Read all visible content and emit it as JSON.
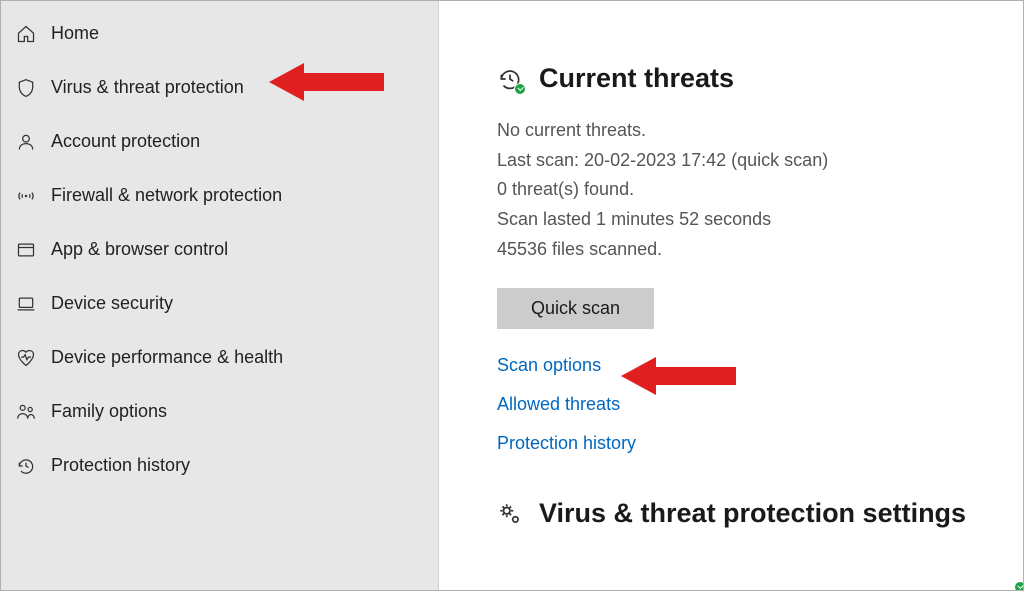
{
  "sidebar": {
    "items": [
      {
        "label": "Home"
      },
      {
        "label": "Virus & threat protection"
      },
      {
        "label": "Account protection"
      },
      {
        "label": "Firewall & network protection"
      },
      {
        "label": "App & browser control"
      },
      {
        "label": "Device security"
      },
      {
        "label": "Device performance & health"
      },
      {
        "label": "Family options"
      },
      {
        "label": "Protection history"
      }
    ]
  },
  "main": {
    "current_threats": {
      "title": "Current threats",
      "status": "No current threats.",
      "last_scan": "Last scan: 20-02-2023 17:42 (quick scan)",
      "threats_found": "0 threat(s) found.",
      "duration": "Scan lasted 1 minutes 52 seconds",
      "files_scanned": "45536 files scanned.",
      "quick_scan_btn": "Quick scan",
      "links": {
        "scan_options": "Scan options",
        "allowed_threats": "Allowed threats",
        "protection_history": "Protection history"
      }
    },
    "settings": {
      "title": "Virus & threat protection settings"
    }
  }
}
